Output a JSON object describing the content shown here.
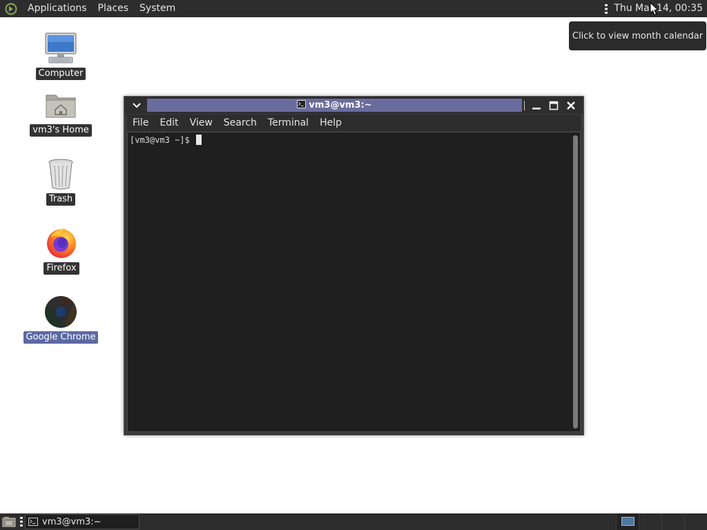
{
  "top_panel": {
    "menus": [
      {
        "label": "Applications"
      },
      {
        "label": "Places"
      },
      {
        "label": "System"
      }
    ],
    "clock": "Thu Mar 14, 00:35"
  },
  "tooltip": {
    "text": "Click to view month calendar"
  },
  "desktop": {
    "icons": [
      {
        "label": "Computer",
        "icon": "computer-icon"
      },
      {
        "label": "vm3's Home",
        "icon": "home-folder-icon"
      },
      {
        "label": "Trash",
        "icon": "trash-icon"
      },
      {
        "label": "Firefox",
        "icon": "firefox-icon"
      },
      {
        "label": "Google Chrome",
        "icon": "chrome-icon",
        "selected": true
      }
    ]
  },
  "terminal": {
    "title": "vm3@vm3:~",
    "menus": [
      {
        "label": "File"
      },
      {
        "label": "Edit"
      },
      {
        "label": "View"
      },
      {
        "label": "Search"
      },
      {
        "label": "Terminal"
      },
      {
        "label": "Help"
      }
    ],
    "prompt": "[vm3@vm3 ~]$ "
  },
  "bottom_panel": {
    "task_label": "vm3@vm3:~"
  },
  "colors": {
    "panel_bg": "#2d2d2d",
    "title_highlight": "#6a6c9e",
    "selected_label": "#5c6aa3",
    "terminal_bg": "#1f1f1f"
  }
}
